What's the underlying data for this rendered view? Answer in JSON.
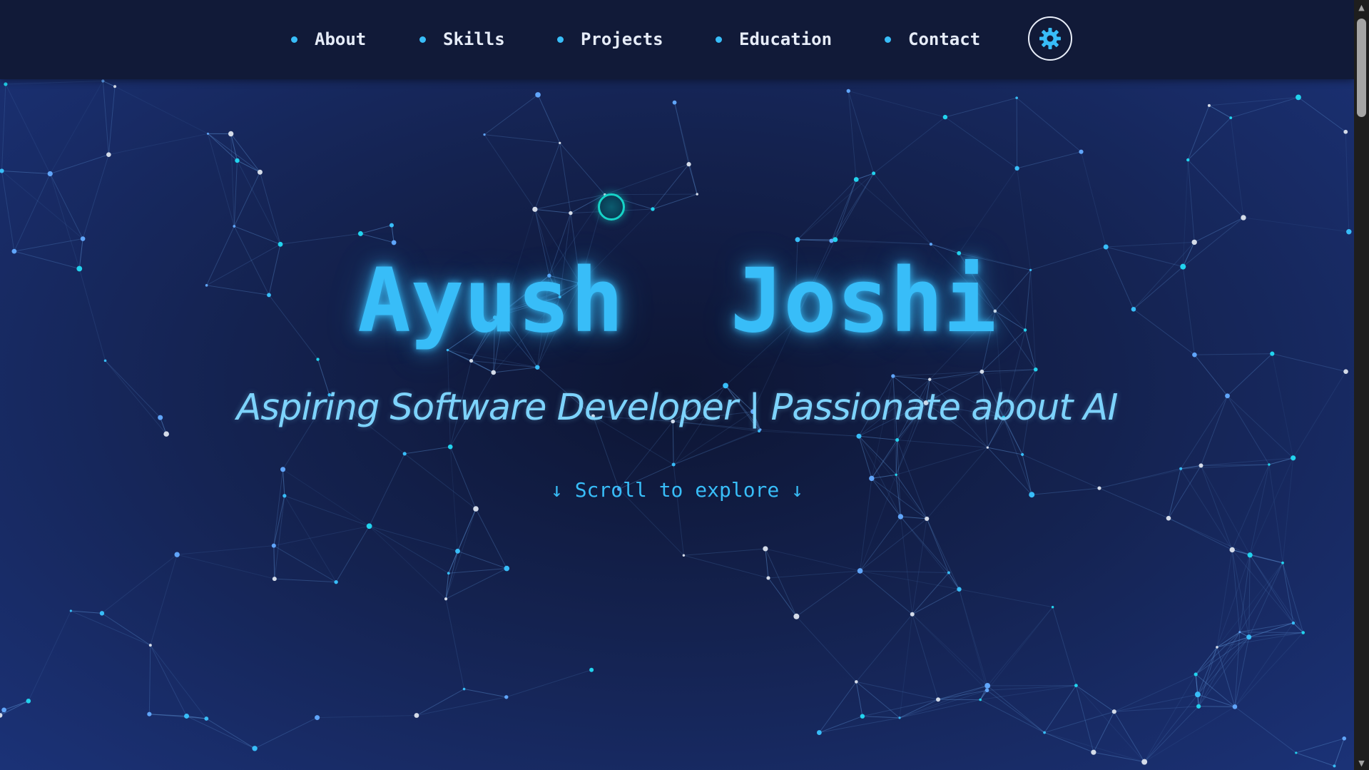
{
  "nav": {
    "items": [
      {
        "label": "About"
      },
      {
        "label": "Skills"
      },
      {
        "label": "Projects"
      },
      {
        "label": "Education"
      },
      {
        "label": "Contact"
      }
    ],
    "theme_toggle_icon": "gear-icon"
  },
  "hero": {
    "name": "Ayush  Joshi",
    "subtitle": "Aspiring Software Developer | Passionate about AI",
    "scroll_hint": "↓ Scroll to explore ↓"
  },
  "colors": {
    "accent": "#38bdf8",
    "subtitle": "#7dd3fc",
    "navbar": "#111a38",
    "cursor": "#16d4c8"
  }
}
